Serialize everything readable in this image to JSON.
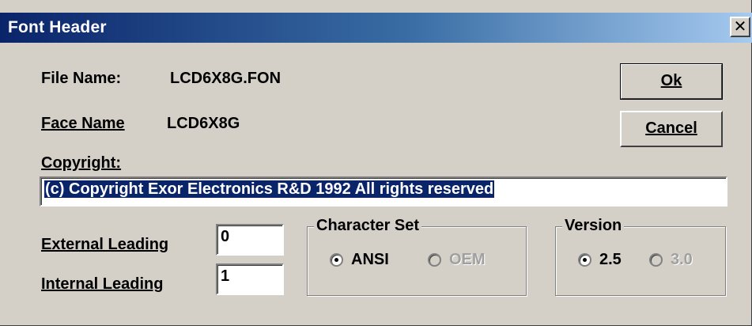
{
  "window": {
    "title": "Font Header",
    "close_glyph": "✕"
  },
  "fields": {
    "file_name_label": "File Name:",
    "file_name_value": "LCD6X8G.FON",
    "face_name_label": "Face Name",
    "face_name_value": "LCD6X8G",
    "copyright_label": "Copyright:",
    "copyright_value": "(c) Copyright Exor Electronics R&D 1992 All rights reserved",
    "external_leading_label": "External Leading",
    "external_leading_value": "0",
    "internal_leading_label": "Internal Leading",
    "internal_leading_value": "1"
  },
  "buttons": {
    "ok": "Ok",
    "cancel": "Cancel"
  },
  "character_set": {
    "title": "Character Set",
    "options": [
      {
        "label": "ANSI",
        "selected": true,
        "enabled": true
      },
      {
        "label": "OEM",
        "selected": false,
        "enabled": false
      }
    ]
  },
  "version": {
    "title": "Version",
    "options": [
      {
        "label": "2.5",
        "selected": true,
        "enabled": true
      },
      {
        "label": "3.0",
        "selected": false,
        "enabled": false
      }
    ]
  },
  "colors": {
    "titlebar": "#0a246a",
    "dialog": "#d4d0c8",
    "selection": "#0a246a"
  },
  "icons": {
    "close": "close-icon",
    "radio": "radio-button-icon"
  }
}
